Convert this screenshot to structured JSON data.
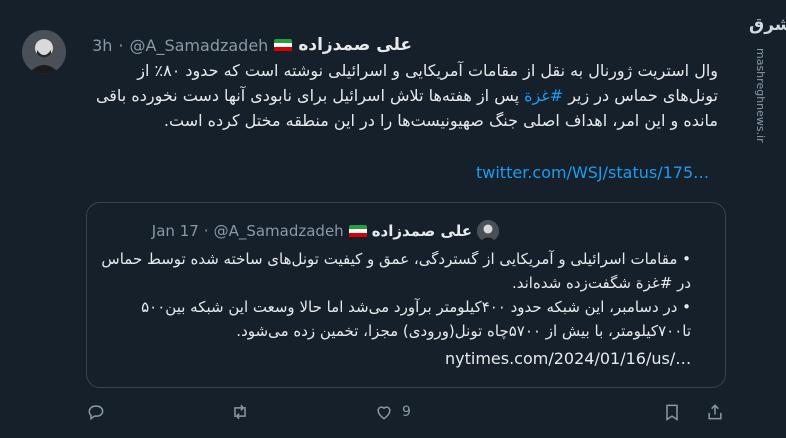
{
  "tweet": {
    "author_name": "علی صمدزاده",
    "author_handle": "@A_Samadzadeh",
    "separator": "·",
    "time": "3h",
    "text_before_hashtag": "وال استریت ژورنال به نقل از مقامات آمریکایی و اسرائیلی نوشته است که حدود ۸۰٪ از تونل‌های حماس در زیر ",
    "hashtag": "#غزة",
    "text_after_hashtag": " پس از هفته‌ها تلاش اسرائیل برای نابودی آنها دست نخورده باقی مانده و این امر، اهداف اصلی جنگ صهیونیست‌ها را در این منطقه مختل کرده است.",
    "link": "twitter.com/WSJ/status/175…"
  },
  "quote": {
    "author_name": "علی صمدزاده",
    "author_handle": "@A_Samadzadeh",
    "separator": "·",
    "date": "Jan 17",
    "paragraph1": "• مقامات اسرائیلی و آمریکایی از گستردگی، عمق و کیفیت تونل‌های ساخته شده توسط حماس در #غزة شگفت‌زده شده‌اند.",
    "paragraph2": "• در دسامبر، این شبکه حدود ۴۰۰کیلومتر برآورد می‌شد اما حالا وسعت این شبکه بین۵۰۰ تا۷۰۰کیلومتر، با بیش از ۵۷۰۰چاه تونل(ورودی) مجزا، تخمین زده می‌شود.",
    "link": "nytimes.com/2024/01/16/us/…"
  },
  "actions": {
    "reply_icon": "reply-icon",
    "retweet_icon": "retweet-icon",
    "like_icon": "like-icon",
    "like_count": "9",
    "bookmark_icon": "bookmark-icon",
    "share_icon": "share-icon"
  },
  "brand": {
    "logo_text": "مشرق",
    "site": "mashreghnews.ir"
  },
  "colors": {
    "background": "#15202b",
    "link": "#1d9bf0",
    "muted": "#8b98a5"
  }
}
